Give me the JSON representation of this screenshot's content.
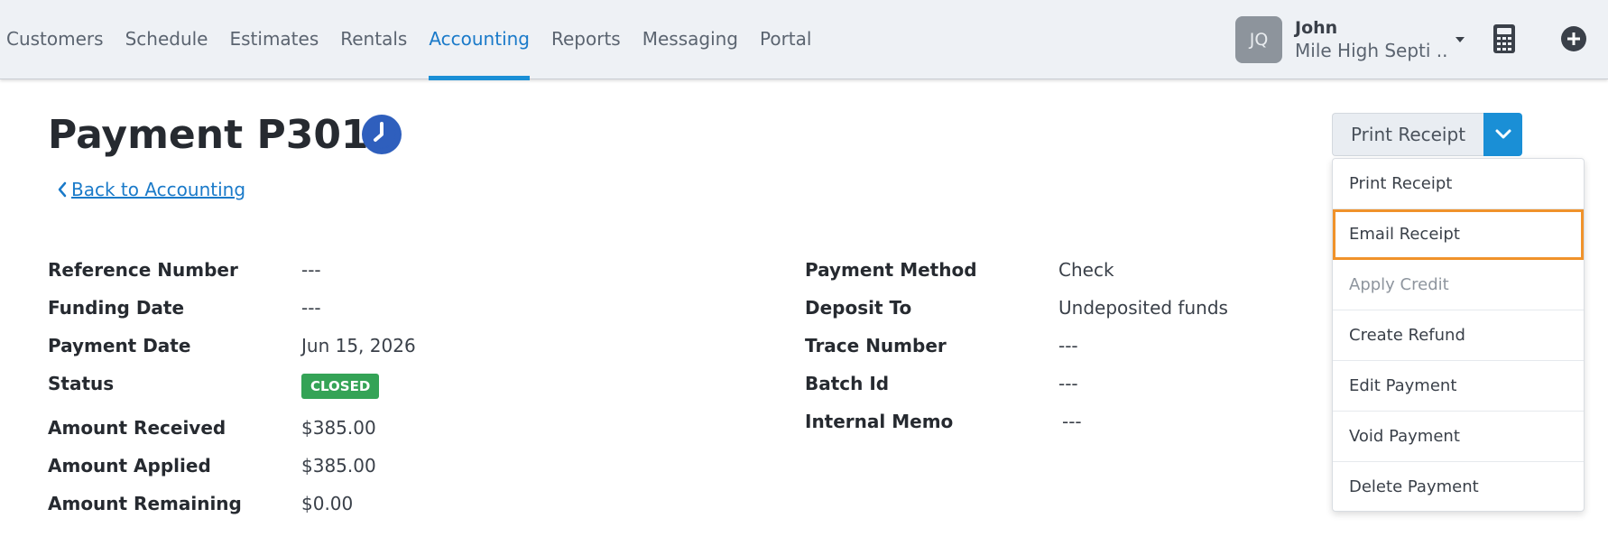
{
  "nav": {
    "items": [
      {
        "label": "Customers"
      },
      {
        "label": "Schedule"
      },
      {
        "label": "Estimates"
      },
      {
        "label": "Rentals"
      },
      {
        "label": "Accounting"
      },
      {
        "label": "Reports"
      },
      {
        "label": "Messaging"
      },
      {
        "label": "Portal"
      }
    ],
    "active": "Accounting"
  },
  "user": {
    "initials": "JQ",
    "name": "John",
    "company": "Mile High Septi ..."
  },
  "icons": {
    "calculator": "calculator-icon",
    "add": "plus-circle-icon",
    "history": "clock-icon",
    "back": "chevron-left-icon",
    "dropdown": "chevron-down-icon",
    "user_menu": "caret-down-icon"
  },
  "page": {
    "title": "Payment P3012",
    "back_link": "Back to Accounting"
  },
  "details_left": [
    {
      "label": "Reference Number",
      "value": "---"
    },
    {
      "label": "Funding Date",
      "value": "---"
    },
    {
      "label": "Payment Date",
      "value": "Jun 15, 2026"
    },
    {
      "label": "Status",
      "value": "CLOSED"
    },
    {
      "label": "Amount Received",
      "value": "$385.00"
    },
    {
      "label": "Amount Applied",
      "value": "$385.00"
    },
    {
      "label": "Amount Remaining",
      "value": "$0.00"
    }
  ],
  "details_right": [
    {
      "label": "Payment Method",
      "value": "Check"
    },
    {
      "label": "Deposit To",
      "value": "Undeposited funds"
    },
    {
      "label": "Trace Number",
      "value": "---"
    },
    {
      "label": "Batch Id",
      "value": "---"
    },
    {
      "label": "Internal Memo",
      "value": "---"
    }
  ],
  "actions": {
    "primary_label": "Print Receipt",
    "menu": [
      {
        "label": "Print Receipt",
        "state": "enabled"
      },
      {
        "label": "Email Receipt",
        "state": "highlighted"
      },
      {
        "label": "Apply Credit",
        "state": "disabled"
      },
      {
        "label": "Create Refund",
        "state": "enabled"
      },
      {
        "label": "Edit Payment",
        "state": "enabled"
      },
      {
        "label": "Void Payment",
        "state": "enabled"
      },
      {
        "label": "Delete Payment",
        "state": "enabled"
      }
    ]
  },
  "colors": {
    "accent": "#1a8fd6",
    "status_closed": "#34a356",
    "highlight": "#f0922a"
  }
}
